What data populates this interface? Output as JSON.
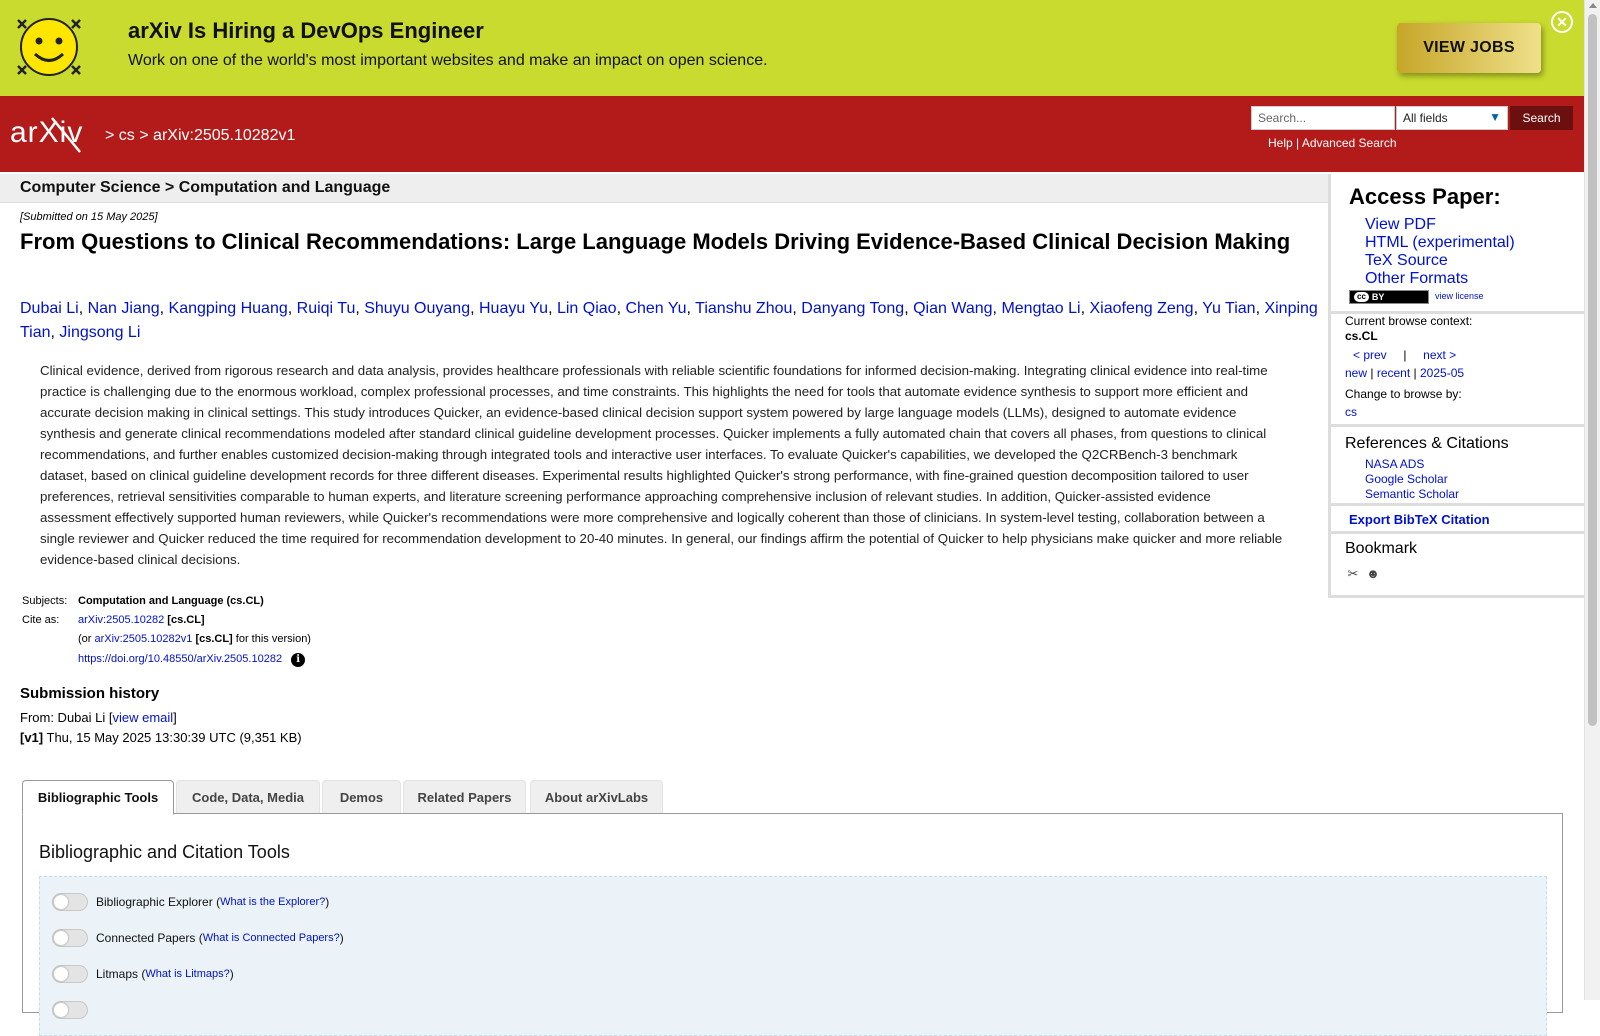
{
  "banner": {
    "title": "arXiv Is Hiring a DevOps Engineer",
    "subtitle": "Work on one of the world's most important websites and make an impact on open science.",
    "button": "VIEW JOBS"
  },
  "header": {
    "logo": "arXiv",
    "breadcrumb_sep": ">",
    "breadcrumb_cs": "cs",
    "breadcrumb_id": "arXiv:2505.10282v1",
    "search_placeholder": "Search...",
    "search_field": "All fields",
    "search_button": "Search",
    "help": "Help",
    "help_sep": "|",
    "advanced": "Advanced Search"
  },
  "paper": {
    "subject_bar": "Computer Science > Computation and Language",
    "submitted": "[Submitted on 15 May 2025]",
    "title": "From Questions to Clinical Recommendations: Large Language Models Driving Evidence-Based Clinical Decision Making",
    "authors": [
      "Dubai Li",
      "Nan Jiang",
      "Kangping Huang",
      "Ruiqi Tu",
      "Shuyu Ouyang",
      "Huayu Yu",
      "Lin Qiao",
      "Chen Yu",
      "Tianshu Zhou",
      "Danyang Tong",
      "Qian Wang",
      "Mengtao Li",
      "Xiaofeng Zeng",
      "Yu Tian",
      "Xinping Tian",
      "Jingsong Li"
    ],
    "abstract": "Clinical evidence, derived from rigorous research and data analysis, provides healthcare professionals with reliable scientific foundations for informed decision-making. Integrating clinical evidence into real-time practice is challenging due to the enormous workload, complex professional processes, and time constraints. This highlights the need for tools that automate evidence synthesis to support more efficient and accurate decision making in clinical settings. This study introduces Quicker, an evidence-based clinical decision support system powered by large language models (LLMs), designed to automate evidence synthesis and generate clinical recommendations modeled after standard clinical guideline development processes. Quicker implements a fully automated chain that covers all phases, from questions to clinical recommendations, and further enables customized decision-making through integrated tools and interactive user interfaces. To evaluate Quicker's capabilities, we developed the Q2CRBench-3 benchmark dataset, based on clinical guideline development records for three different diseases. Experimental results highlighted Quicker's strong performance, with fine-grained question decomposition tailored to user preferences, retrieval sensitivities comparable to human experts, and literature screening performance approaching comprehensive inclusion of relevant studies. In addition, Quicker-assisted evidence assessment effectively supported human reviewers, while Quicker's recommendations were more comprehensive and logically coherent than those of clinicians. In system-level testing, collaboration between a single reviewer and Quicker reduced the time required for recommendation development to 20-40 minutes. In general, our findings affirm the potential of Quicker to help physicians make quicker and more reliable evidence-based clinical decisions.",
    "subjects_label": "Subjects:",
    "subjects_value": "Computation and Language (cs.CL)",
    "cite_label": "Cite as:",
    "cite_id": "arXiv:2505.10282",
    "cite_tag": "[cs.CL]",
    "cite_or": "(or",
    "cite_version_id": "arXiv:2505.10282v1",
    "cite_version_tag": "[cs.CL]",
    "cite_version_suffix": "for this version)",
    "doi": "https://doi.org/10.48550/arXiv.2505.10282",
    "info_glyph": "i"
  },
  "history": {
    "title": "Submission history",
    "from_prefix": "From: Dubai Li [",
    "view_email": "view email",
    "from_suffix": "]",
    "v1_label": "[v1]",
    "v1_text": " Thu, 15 May 2025 13:30:39 UTC (9,351 KB)"
  },
  "tabs": [
    "Bibliographic Tools",
    "Code, Data, Media",
    "Demos",
    "Related Papers",
    "About arXivLabs"
  ],
  "tools": {
    "panel_title": "Bibliographic and Citation Tools",
    "items": [
      {
        "name": "Bibliographic Explorer",
        "link": "What is the Explorer?"
      },
      {
        "name": "Connected Papers",
        "link": "What is Connected Papers?"
      },
      {
        "name": "Litmaps",
        "link": "What is Litmaps?"
      }
    ]
  },
  "sidebar": {
    "access_title": "Access Paper:",
    "access_links": [
      "View PDF",
      "HTML (experimental)",
      "TeX Source",
      "Other Formats"
    ],
    "cc_label": "BY",
    "cc_mark": "cc",
    "view_license": "view license",
    "context_label": "Current browse context:",
    "context_value": "cs.CL",
    "prev": "< prev",
    "nav_sep": "|",
    "next": "next >",
    "new": "new",
    "recent": "recent",
    "month": "2025-05",
    "change_label": "Change to browse by:",
    "change_value": "cs",
    "refs_title": "References & Citations",
    "refs": [
      "NASA ADS",
      "Google Scholar",
      "Semantic Scholar"
    ],
    "bibtex": "Export BibTeX Citation",
    "bookmark_title": "Bookmark"
  },
  "colors": {
    "banner_bg": "#c8db2e",
    "header_bg": "#b31b1b",
    "link": "#0011cc",
    "search_button_bg": "#6b0f0f"
  }
}
